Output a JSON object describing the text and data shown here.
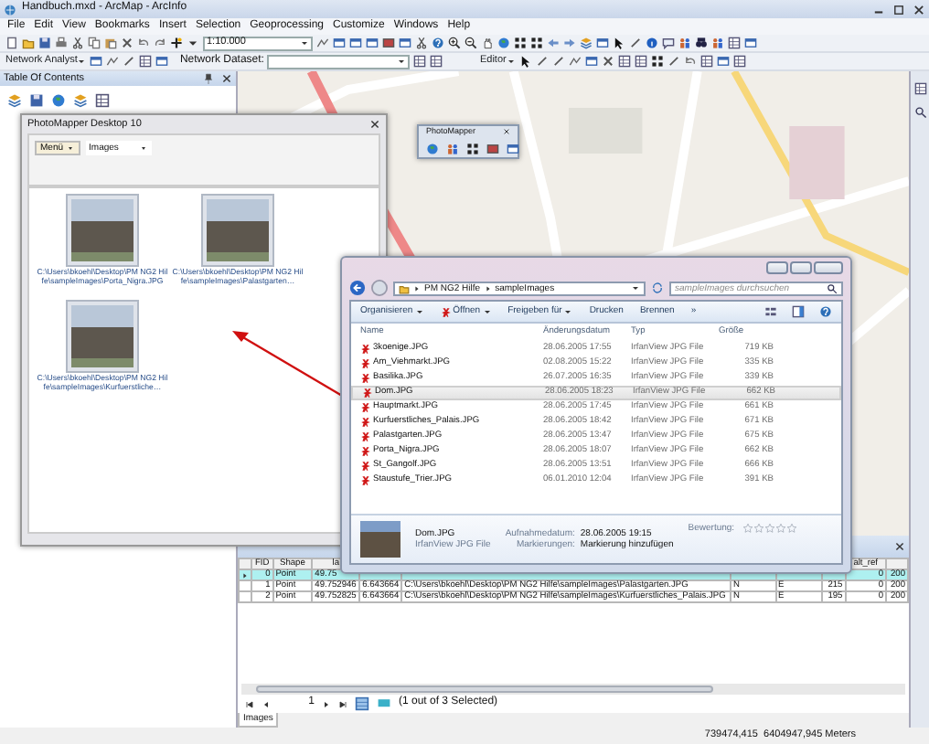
{
  "window": {
    "title": "Handbuch.mxd - ArcMap - ArcInfo"
  },
  "menu": [
    "File",
    "Edit",
    "View",
    "Bookmarks",
    "Insert",
    "Selection",
    "Geoprocessing",
    "Customize",
    "Windows",
    "Help"
  ],
  "toolbar": {
    "scale": "1:10.000"
  },
  "toolbar_2": {
    "network_analyst": "Network Analyst",
    "network_dataset_label": "Network Dataset:",
    "editor": "Editor"
  },
  "toc": {
    "title": "Table Of Contents"
  },
  "photomapper_toolbar": {
    "title": "PhotoMapper"
  },
  "photomapper": {
    "title": "PhotoMapper Desktop 10",
    "menu_button": "Menü",
    "layer_select": "Images",
    "thumbnails": [
      {
        "caption": "C:\\Users\\bkoehl\\Desktop\\PM NG2 Hilfe\\sampleImages\\Porta_Nigra.JPG"
      },
      {
        "caption": "C:\\Users\\bkoehl\\Desktop\\PM NG2 Hilfe\\sampleImages\\Palastgarten…"
      },
      {
        "caption": "C:\\Users\\bkoehl\\Desktop\\PM NG2 Hilfe\\sampleImages\\Kurfuerstliche…"
      }
    ]
  },
  "explorer": {
    "path": [
      "PM NG2 Hilfe",
      "sampleImages"
    ],
    "search_placeholder": "sampleImages durchsuchen",
    "commands": [
      {
        "label": "Organisieren",
        "dropdown": true
      },
      {
        "label": "Öffnen",
        "dropdown": true
      },
      {
        "label": "Freigeben für",
        "dropdown": true
      },
      {
        "label": "Drucken",
        "dropdown": false
      },
      {
        "label": "Brennen",
        "dropdown": false
      },
      {
        "label": "»",
        "dropdown": false
      }
    ],
    "columns": [
      "Name",
      "Änderungsdatum",
      "Typ",
      "Größe"
    ],
    "files": [
      {
        "name": "3koenige.JPG",
        "date": "28.06.2005 17:55",
        "type": "IrfanView JPG File",
        "size": "719 KB",
        "selected": false
      },
      {
        "name": "Am_Viehmarkt.JPG",
        "date": "02.08.2005 15:22",
        "type": "IrfanView JPG File",
        "size": "335 KB",
        "selected": false
      },
      {
        "name": "Basilika.JPG",
        "date": "26.07.2005 16:35",
        "type": "IrfanView JPG File",
        "size": "339 KB",
        "selected": false
      },
      {
        "name": "Dom.JPG",
        "date": "28.06.2005 18:23",
        "type": "IrfanView JPG File",
        "size": "662 KB",
        "selected": true
      },
      {
        "name": "Hauptmarkt.JPG",
        "date": "28.06.2005 17:45",
        "type": "IrfanView JPG File",
        "size": "661 KB",
        "selected": false
      },
      {
        "name": "Kurfuerstliches_Palais.JPG",
        "date": "28.06.2005 18:42",
        "type": "IrfanView JPG File",
        "size": "671 KB",
        "selected": false
      },
      {
        "name": "Palastgarten.JPG",
        "date": "28.06.2005 13:47",
        "type": "IrfanView JPG File",
        "size": "675 KB",
        "selected": false
      },
      {
        "name": "Porta_Nigra.JPG",
        "date": "28.06.2005 18:07",
        "type": "IrfanView JPG File",
        "size": "662 KB",
        "selected": false
      },
      {
        "name": "St_Gangolf.JPG",
        "date": "28.06.2005 13:51",
        "type": "IrfanView JPG File",
        "size": "666 KB",
        "selected": false
      },
      {
        "name": "Staustufe_Trier.JPG",
        "date": "06.01.2010 12:04",
        "type": "IrfanView JPG File",
        "size": "391 KB",
        "selected": false
      }
    ],
    "details": {
      "name": "Dom.JPG",
      "type": "IrfanView JPG File",
      "date_label": "Aufnahmedatum:",
      "date": "28.06.2005 19:15",
      "tags_label": "Markierungen:",
      "tags": "Markierung hinzufügen",
      "rating_label": "Bewertung:",
      "stars": 0
    }
  },
  "table": {
    "columns": [
      {
        "label": "FID"
      },
      {
        "label": "Shape"
      },
      {
        "label": "la"
      },
      {},
      {},
      {},
      {},
      {},
      {
        "label": "alt_ref"
      },
      {}
    ],
    "rows": [
      {
        "selected": true,
        "cells": [
          "0",
          "Point",
          "49.75",
          null,
          null,
          null,
          null,
          null,
          "0",
          "200"
        ]
      },
      {
        "selected": false,
        "cells": [
          "1",
          "Point",
          "49.752946",
          "6.643664",
          "C:\\Users\\bkoehl\\Desktop\\PM NG2 Hilfe\\sampleImages\\Palastgarten.JPG",
          "N",
          "E",
          "215",
          "0",
          "200"
        ]
      },
      {
        "selected": false,
        "cells": [
          "2",
          "Point",
          "49.752825",
          "6.643664",
          "C:\\Users\\bkoehl\\Desktop\\PM NG2 Hilfe\\sampleImages\\Kurfuerstliches_Palais.JPG",
          "N",
          "E",
          "195",
          "0",
          "200"
        ]
      }
    ],
    "record": "1",
    "selection_status": "(1 out of 3 Selected)",
    "tab": "Images"
  },
  "status_bar": {
    "coordinates": "739474,415  6404947,945 Meters"
  }
}
